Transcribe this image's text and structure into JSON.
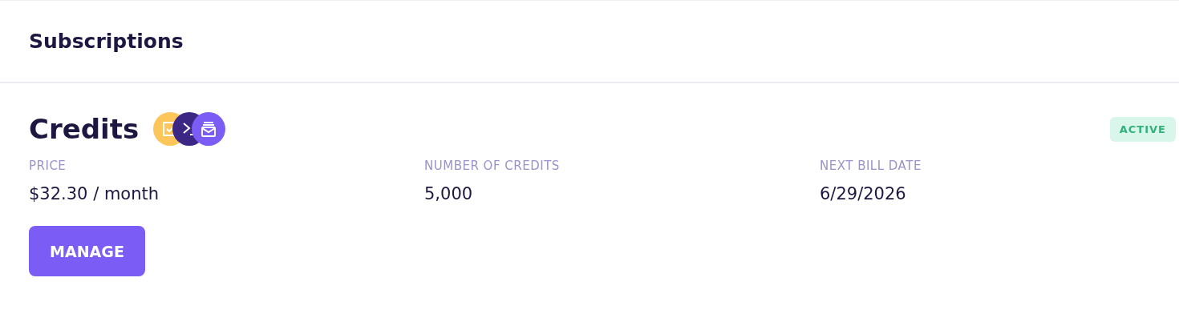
{
  "header": {
    "title": "Subscriptions"
  },
  "subscription": {
    "name": "Credits",
    "products": [
      {
        "kind": "checkbox",
        "color": "#fcc65b"
      },
      {
        "kind": "terminal",
        "color": "#3d2785"
      },
      {
        "kind": "inbox",
        "color": "#7b5cf5"
      }
    ],
    "status": {
      "label": "ACTIVE",
      "kind": "active"
    },
    "fields": [
      {
        "label": "PRICE",
        "value": "$32.30 / month"
      },
      {
        "label": "NUMBER OF CREDITS",
        "value": "5,000"
      },
      {
        "label": "NEXT BILL DATE",
        "value": "6/29/2026"
      }
    ],
    "button": {
      "label": "MANAGE"
    }
  }
}
